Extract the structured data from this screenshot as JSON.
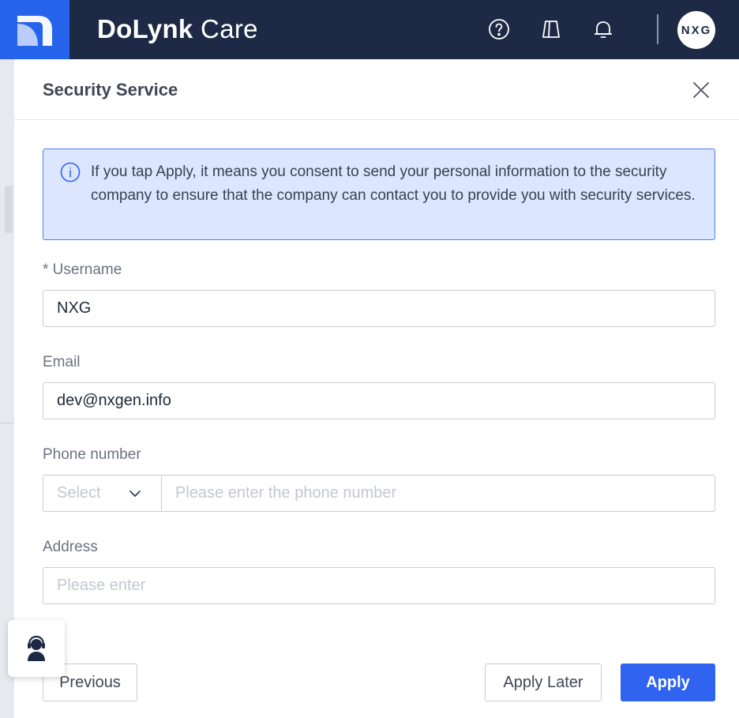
{
  "app": {
    "brand_bold": "DoLynk",
    "brand_light": " Care",
    "avatar_text": "NXG",
    "colors": {
      "header_bg": "#1e2a45",
      "logo_bg": "#2563eb",
      "primary": "#2f63f0",
      "notice_bg": "#dde6ff",
      "notice_border": "#4c7ff0"
    },
    "icons": [
      "help-icon",
      "door-icon",
      "bell-icon",
      "support-agent-icon"
    ]
  },
  "dialog": {
    "title": "Security Service",
    "notice": "If you tap Apply, it means you consent to send your personal information to the security company to ensure that the company can contact you to provide you with security services.",
    "fields": {
      "username": {
        "label": "* Username",
        "value": "NXG"
      },
      "email": {
        "label": "Email",
        "value": "dev@nxgen.info"
      },
      "phone": {
        "label": "Phone number",
        "select_placeholder": "Select",
        "placeholder": "Please enter the phone number"
      },
      "address": {
        "label": "Address",
        "placeholder": "Please enter"
      }
    },
    "buttons": {
      "previous": "Previous",
      "apply_later": "Apply Later",
      "apply": "Apply"
    }
  }
}
